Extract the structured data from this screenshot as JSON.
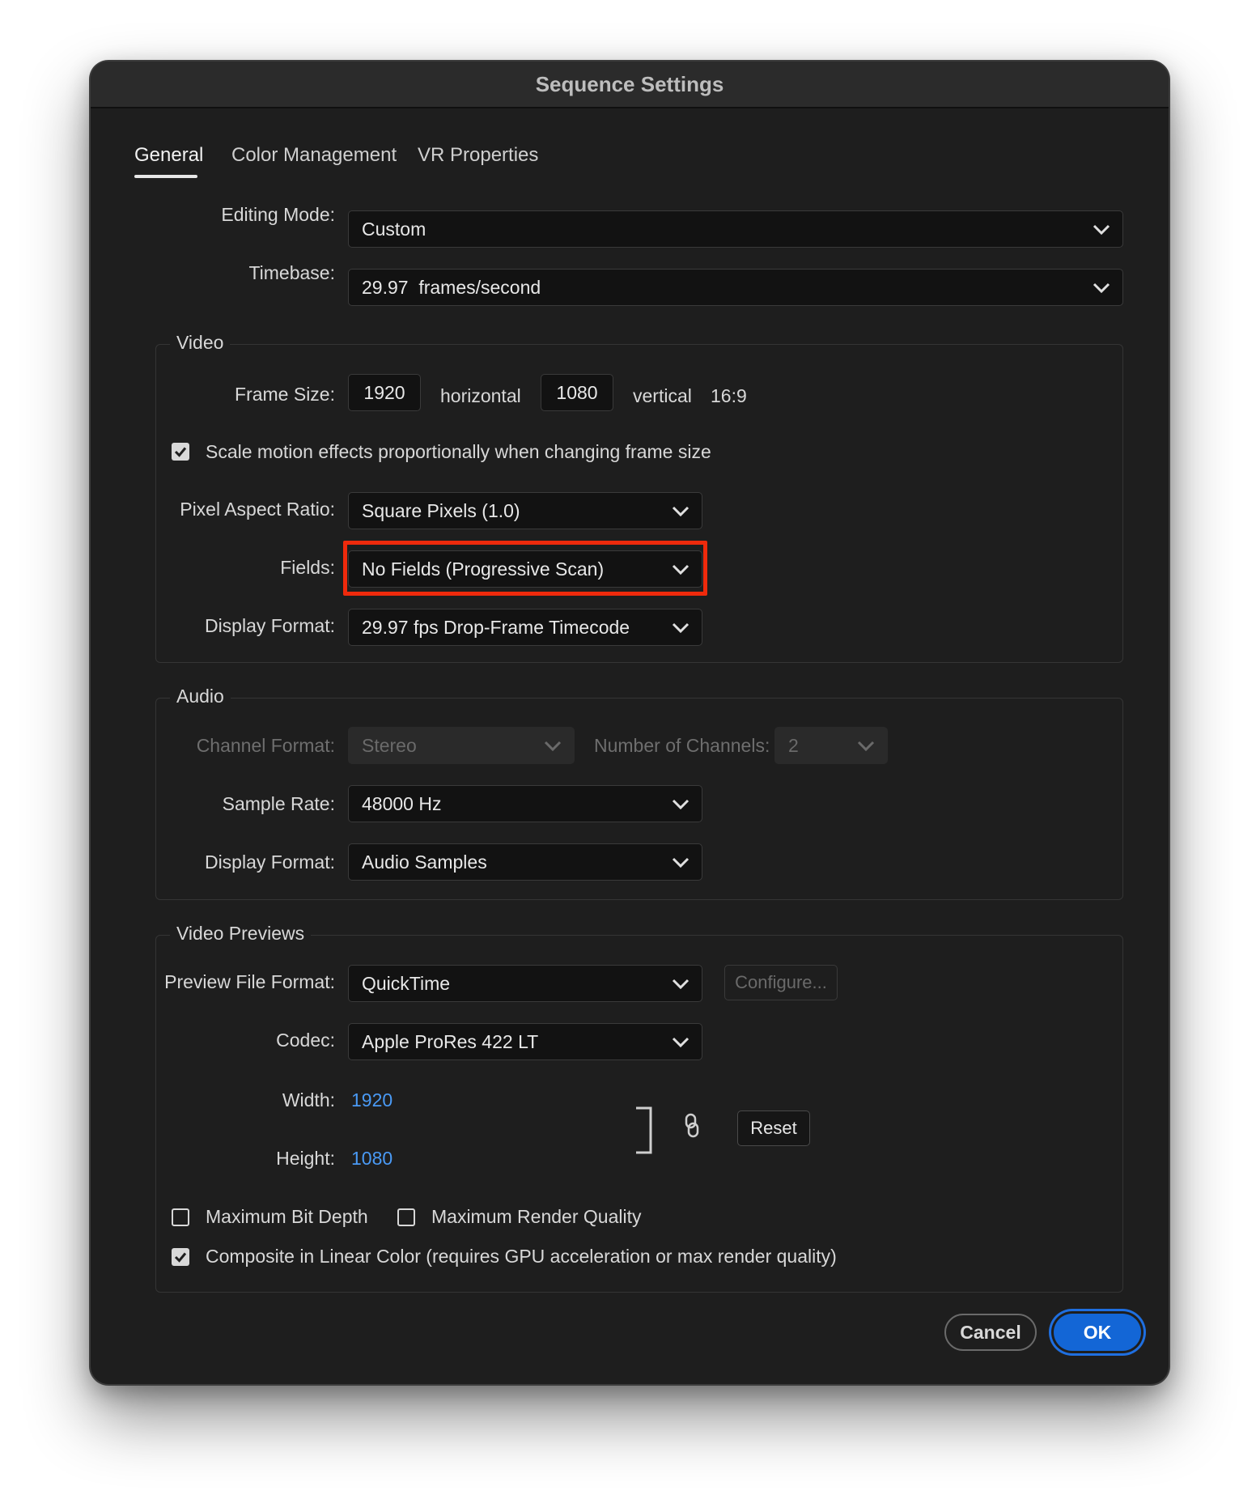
{
  "dialog": {
    "title": "Sequence Settings"
  },
  "tabs": [
    {
      "label": "General",
      "active": true
    },
    {
      "label": "Color Management",
      "active": false
    },
    {
      "label": "VR Properties",
      "active": false
    }
  ],
  "general": {
    "editing_mode_label": "Editing Mode:",
    "editing_mode_value": "Custom",
    "timebase_label": "Timebase:",
    "timebase_value": "29.97  frames/second"
  },
  "video": {
    "group_label": "Video",
    "frame_size_label": "Frame Size:",
    "frame_width": "1920",
    "horizontal_label": "horizontal",
    "frame_height": "1080",
    "vertical_label": "vertical",
    "aspect_text": "16:9",
    "scale_motion_label": "Scale motion effects proportionally when changing frame size",
    "scale_motion_checked": true,
    "pixel_aspect_label": "Pixel Aspect Ratio:",
    "pixel_aspect_value": "Square Pixels (1.0)",
    "fields_label": "Fields:",
    "fields_value": "No Fields (Progressive Scan)",
    "display_format_label": "Display Format:",
    "display_format_value": "29.97 fps Drop-Frame Timecode"
  },
  "audio": {
    "group_label": "Audio",
    "channel_format_label": "Channel Format:",
    "channel_format_value": "Stereo",
    "num_channels_label": "Number of Channels:",
    "num_channels_value": "2",
    "sample_rate_label": "Sample Rate:",
    "sample_rate_value": "48000 Hz",
    "display_format_label": "Display Format:",
    "display_format_value": "Audio Samples"
  },
  "previews": {
    "group_label": "Video Previews",
    "file_format_label": "Preview File Format:",
    "file_format_value": "QuickTime",
    "configure_label": "Configure...",
    "codec_label": "Codec:",
    "codec_value": "Apple ProRes 422 LT",
    "width_label": "Width:",
    "width_value": "1920",
    "height_label": "Height:",
    "height_value": "1080",
    "reset_label": "Reset",
    "max_bit_depth_label": "Maximum Bit Depth",
    "max_bit_depth_checked": false,
    "max_render_quality_label": "Maximum Render Quality",
    "max_render_quality_checked": false,
    "linear_color_label": "Composite in Linear Color (requires GPU acceleration or max render quality)",
    "linear_color_checked": true
  },
  "footer": {
    "cancel_label": "Cancel",
    "ok_label": "OK"
  },
  "colors": {
    "accent": "#1366d6",
    "highlight": "#ef2a0c",
    "link": "#4a9af5"
  }
}
